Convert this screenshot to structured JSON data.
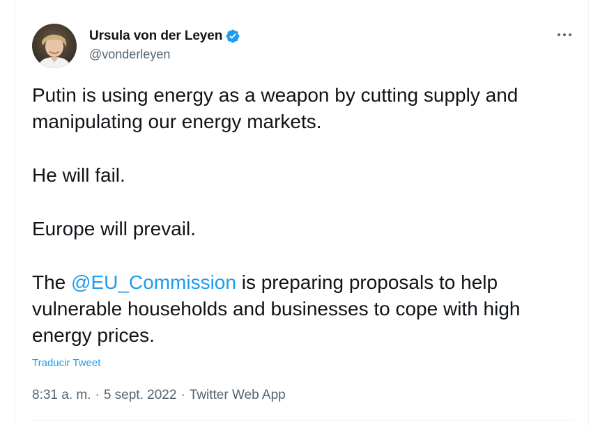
{
  "author": {
    "display_name": "Ursula von der Leyen",
    "handle": "@vonderleyen",
    "verified": true,
    "verified_icon": "verified-badge-icon"
  },
  "colors": {
    "accent": "#1d9bf0",
    "text": "#0f1419",
    "secondary": "#536471"
  },
  "tweet": {
    "paragraph_1": "Putin is using energy as a weapon by cutting supply and manipulating our energy markets.",
    "paragraph_2": "He will fail.",
    "paragraph_3": "Europe will prevail.",
    "paragraph_4_prefix": "The ",
    "mention": "@EU_Commission",
    "paragraph_4_suffix": " is preparing proposals to help vulnerable households and businesses to cope with high energy prices."
  },
  "translate_label": "Traducir Tweet",
  "meta": {
    "time": "8:31 a. m.",
    "separator": "·",
    "date": "5 sept. 2022",
    "source": "Twitter Web App"
  },
  "more_menu_icon": "more-horizontal-icon"
}
